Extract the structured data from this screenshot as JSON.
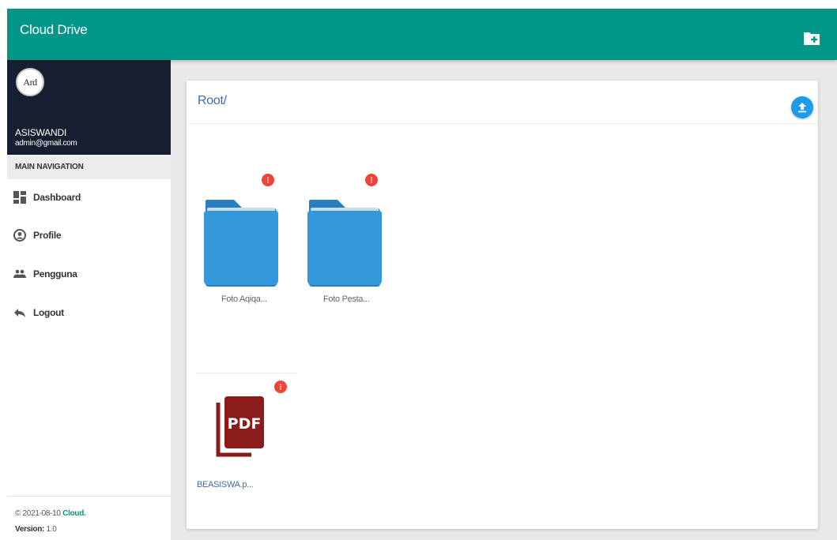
{
  "app": {
    "title": "Cloud Drive"
  },
  "user": {
    "avatar_text": "Ard",
    "name": "ASISWANDI",
    "email": "admin@gmail.com"
  },
  "nav": {
    "header": "MAIN NAVIGATION",
    "items": [
      {
        "label": "Dashboard",
        "icon": "dashboard-icon"
      },
      {
        "label": "Profile",
        "icon": "profile-icon"
      },
      {
        "label": "Pengguna",
        "icon": "people-icon"
      },
      {
        "label": "Logout",
        "icon": "logout-icon"
      }
    ]
  },
  "footer": {
    "date": "© 2021-08-10",
    "brand": "Cloud.",
    "version_label": "Version:",
    "version": "1.0"
  },
  "breadcrumb": {
    "root": "Root",
    "separator": "/"
  },
  "files": [
    {
      "name": "Foto Aqiqa...",
      "type": "folder"
    },
    {
      "name": "Foto Pesta...",
      "type": "folder"
    },
    {
      "name": "BEASISWA.p...",
      "type": "pdf"
    }
  ],
  "colors": {
    "topbar": "#009688",
    "user_panel": "#161f30",
    "folder": "#3498db",
    "menu_dot": "#f44336",
    "upload": "#1e9be9",
    "pdf": "#8b1a1a"
  }
}
